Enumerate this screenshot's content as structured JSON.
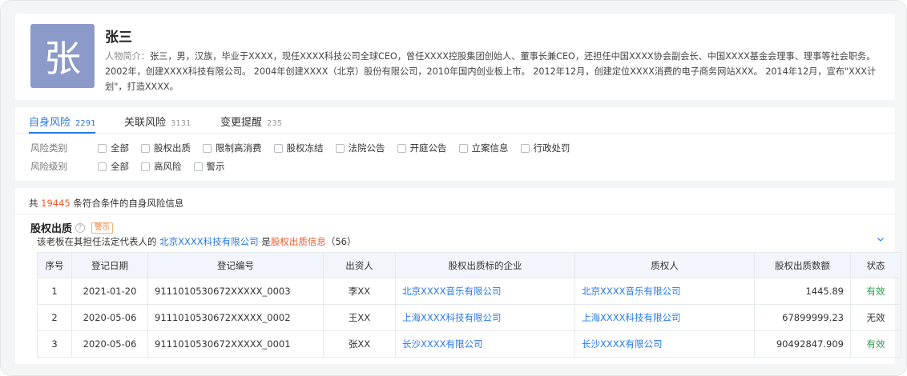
{
  "profile": {
    "avatar_char": "张",
    "name": "张三",
    "bio_label": "人物简介：",
    "bio_text": "张三，男，汉族，毕业于XXXX，现任XXXX科技公司全球CEO，曾任XXXX控股集团创始人、董事长兼CEO，还担任中国XXXX协会副会长、中国XXXX基金会理事、理事等社会职务。2002年，创建XXXX科技有限公司。 2004年创建XXXX（北京）股份有限公司，2010年国内创业板上市。 2012年12月，创建定位XXXX消费的电子商务网站XXX。 2014年12月，宣布\"XXX计划\"，打造XXXX。"
  },
  "tabs": [
    {
      "label": "自身风险",
      "count": "2291",
      "active": true
    },
    {
      "label": "关联风险",
      "count": "3131",
      "active": false
    },
    {
      "label": "变更提醒",
      "count": "235",
      "active": false
    }
  ],
  "filters": {
    "risk_type": {
      "label": "风险类别",
      "options": [
        "全部",
        "股权出质",
        "限制高消费",
        "股权冻结",
        "法院公告",
        "开庭公告",
        "立案信息",
        "行政处罚"
      ]
    },
    "risk_level": {
      "label": "风险级别",
      "options": [
        "全部",
        "高风险",
        "警示"
      ]
    }
  },
  "results": {
    "total_prefix": "共",
    "total_count": "19445",
    "total_suffix": "条符合条件的自身风险信息"
  },
  "section": {
    "title": "股权出质",
    "help_icon": "question-circle-icon",
    "tag": "警示",
    "desc_prefix": "该老板在其担任法定代表人的",
    "desc_company": "北京XXXX科技有限公司",
    "desc_mid": "是",
    "desc_highlight": "股权出质信息",
    "desc_count": "（56）",
    "collapse_icon": "chevron-down-icon"
  },
  "table": {
    "headers": [
      "序号",
      "登记日期",
      "登记编号",
      "出资人",
      "股权出质标的企业",
      "质权人",
      "股权出质数额",
      "状态"
    ],
    "rows": [
      [
        "1",
        "2021-01-20",
        "9111010530672XXXXX_0003",
        "李XX",
        "北京XXXX音乐有限公司",
        "北京XXXX音乐有限公司",
        "1445.89",
        "有效"
      ],
      [
        "2",
        "2020-05-06",
        "9111010530672XXXXX_0002",
        "王XX",
        "上海XXXX科技有限公司",
        "上海XXXX科技有限公司",
        "67899999.23",
        "无效"
      ],
      [
        "3",
        "2020-05-06",
        "9111010530672XXXXX_0001",
        "张XX",
        "长沙XXXX有限公司",
        "长沙XXXX有限公司",
        "90492847.909",
        "有效"
      ]
    ]
  },
  "colors": {
    "accent": "#2878e6",
    "highlight": "#f05a28",
    "valid": "#22a04b",
    "avatar_bg": "#8c9ac9"
  }
}
